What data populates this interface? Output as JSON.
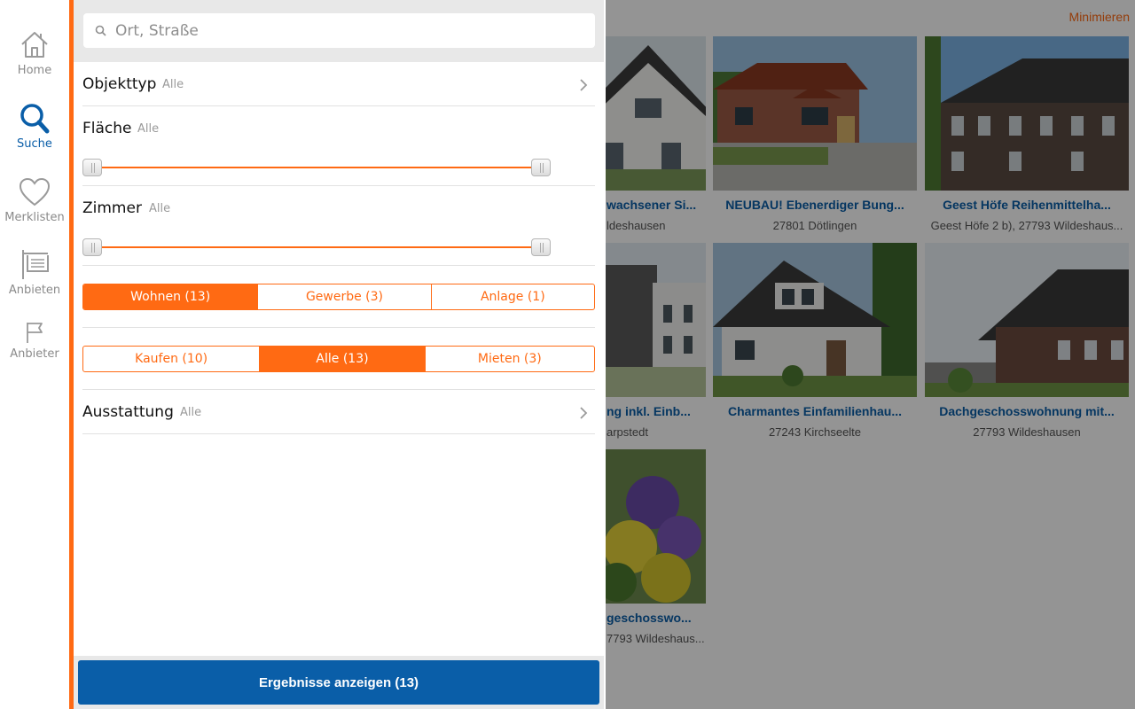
{
  "nav": {
    "items": [
      {
        "label": "Home",
        "icon": "home-icon"
      },
      {
        "label": "Suche",
        "icon": "search-icon",
        "active": true
      },
      {
        "label": "Merklisten",
        "icon": "heart-icon"
      },
      {
        "label": "Anbieten",
        "icon": "sign-icon"
      },
      {
        "label": "Anbieter",
        "icon": "flag-icon"
      }
    ],
    "accent": "#ff6a13",
    "active_color": "#0a5ea8"
  },
  "search": {
    "placeholder": "Ort, Straße"
  },
  "filters": {
    "objekttyp": {
      "title": "Objekttyp",
      "value": "Alle"
    },
    "flaeche": {
      "title": "Fläche",
      "value": "Alle"
    },
    "zimmer": {
      "title": "Zimmer",
      "value": "Alle"
    },
    "usage": [
      "Wohnen (13)",
      "Gewerbe (3)",
      "Anlage (1)"
    ],
    "usage_selected": "Wohnen (13)",
    "deal": [
      "Kaufen (10)",
      "Alle (13)",
      "Mieten (3)"
    ],
    "deal_selected": "Alle (13)",
    "ausstattung": {
      "title": "Ausstattung",
      "value": "Alle"
    }
  },
  "footer": {
    "button_label": "Ergebnisse anzeigen (13)"
  },
  "results": {
    "minimize_label": "Minimieren",
    "cards": [
      {
        "title": "wachsener Si...",
        "address": "ldeshausen"
      },
      {
        "title": "NEUBAU! Ebenerdiger Bung...",
        "address": "27801 Dötlingen"
      },
      {
        "title": "Geest Höfe Reihenmittelha...",
        "address": "Geest Höfe 2 b), 27793 Wildeshaus..."
      },
      {
        "title": "ng inkl. Einb...",
        "address": "arpstedt"
      },
      {
        "title": "Charmantes Einfamilienhau...",
        "address": "27243 Kirchseelte"
      },
      {
        "title": "Dachgeschosswohnung mit...",
        "address": "27793 Wildeshausen"
      },
      {
        "title": "geschosswo...",
        "address": "7793 Wildeshaus..."
      }
    ]
  }
}
